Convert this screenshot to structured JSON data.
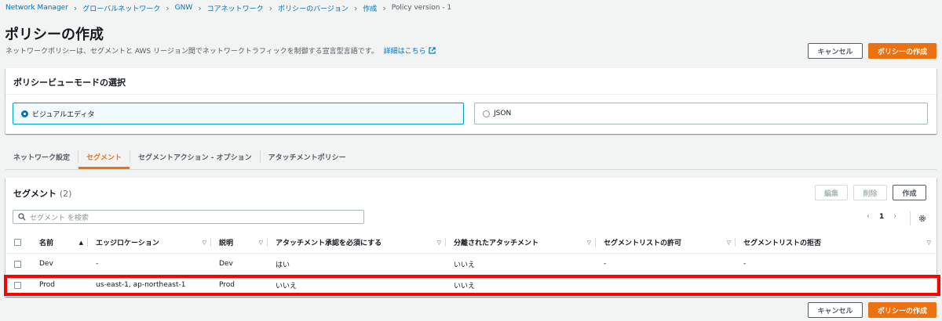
{
  "breadcrumb": {
    "items": [
      "Network Manager",
      "グローバルネットワーク",
      "GNW",
      "コアネットワーク",
      "ポリシーのバージョン",
      "作成"
    ],
    "current": "Policy version - 1"
  },
  "page": {
    "title": "ポリシーの作成",
    "description": "ネットワークポリシーは、セグメントと AWS リージョン間でネットワークトラフィックを制御する宣言型言語です。",
    "info_link": "詳細はこちら"
  },
  "actions": {
    "cancel": "キャンセル",
    "create": "ポリシーの作成"
  },
  "view_mode": {
    "title": "ポリシービューモードの選択",
    "options": [
      {
        "label": "ビジュアルエディタ",
        "selected": true
      },
      {
        "label": "JSON",
        "selected": false
      }
    ]
  },
  "tabs": [
    {
      "label": "ネットワーク設定",
      "active": false
    },
    {
      "label": "セグメント",
      "active": true
    },
    {
      "label": "セグメントアクション - オプション",
      "active": false
    },
    {
      "label": "アタッチメントポリシー",
      "active": false
    }
  ],
  "segments": {
    "title": "セグメント",
    "count": "(2)",
    "buttons": {
      "edit": "編集",
      "delete": "削除",
      "create": "作成"
    },
    "search_placeholder": "セグメント を検索",
    "page_number": "1",
    "columns": [
      "名前",
      "エッジロケーション",
      "説明",
      "アタッチメント承認を必須にする",
      "分離されたアタッチメント",
      "セグメントリストの許可",
      "セグメントリストの拒否"
    ],
    "rows": [
      [
        "Dev",
        "-",
        "Dev",
        "はい",
        "いいえ",
        "-",
        "-"
      ],
      [
        "Prod",
        "us-east-1, ap-northeast-1",
        "Prod",
        "いいえ",
        "いいえ",
        "",
        ""
      ]
    ]
  },
  "colors": {
    "accent": "#ec7211",
    "link": "#0073bb",
    "highlight": "#ff0000"
  }
}
